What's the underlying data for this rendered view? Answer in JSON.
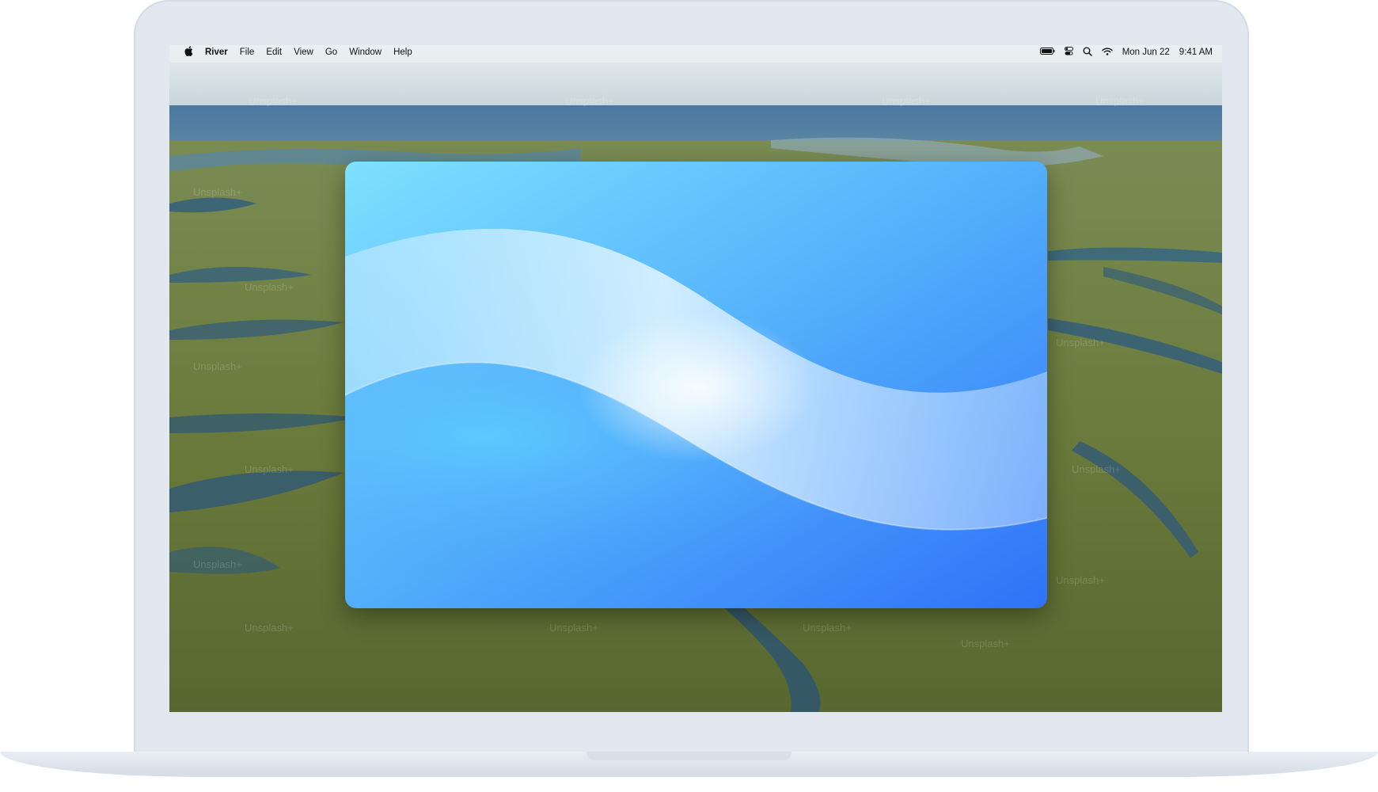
{
  "menubar": {
    "apple_icon": "apple-icon",
    "app_name": "River",
    "items": [
      "File",
      "Edit",
      "View",
      "Go",
      "Window",
      "Help"
    ],
    "status": {
      "icons": [
        "battery-icon",
        "control-center-icon",
        "search-icon",
        "wifi-icon"
      ],
      "date": "Mon Jun 22",
      "time": "9:41 AM"
    }
  },
  "wallpaper": {
    "watermark": "Unsplash+"
  },
  "colors": {
    "window_top_left": "#7fe0ff",
    "window_bottom_right": "#2f72f8",
    "wave_highlight": "#d8f3ff",
    "marsh_green": "#6c7c3e",
    "water": "#3a6478"
  }
}
